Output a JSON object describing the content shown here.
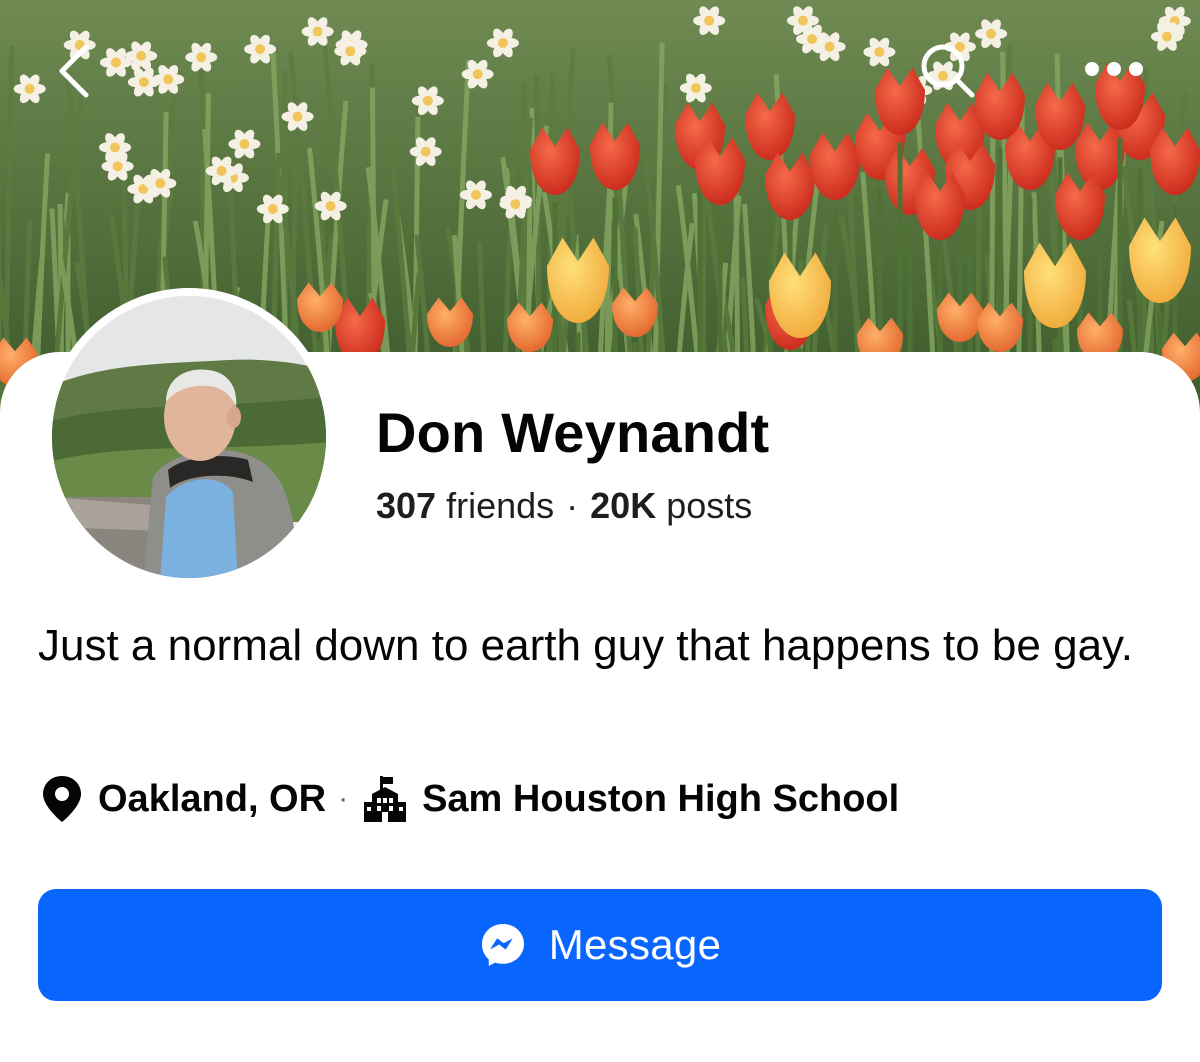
{
  "cover": {
    "description_icon": "tulip-garden-photo"
  },
  "nav": {
    "back_icon": "chevron-left-icon",
    "search_icon": "search-icon",
    "more_icon": "more-horizontal-icon"
  },
  "profile": {
    "name": "Don Weynandt",
    "friends_count": "307",
    "friends_label": "friends",
    "posts_count": "20K",
    "posts_label": "posts",
    "stats_separator": "·",
    "bio": "Just a normal down to earth guy that happens to be gay.",
    "location": "Oakland, OR",
    "details_separator": "·",
    "school": "Sam Houston High School"
  },
  "actions": {
    "message_label": "Message",
    "message_icon": "messenger-icon"
  },
  "colors": {
    "primary_button": "#0866ff",
    "text_primary": "#050505"
  }
}
